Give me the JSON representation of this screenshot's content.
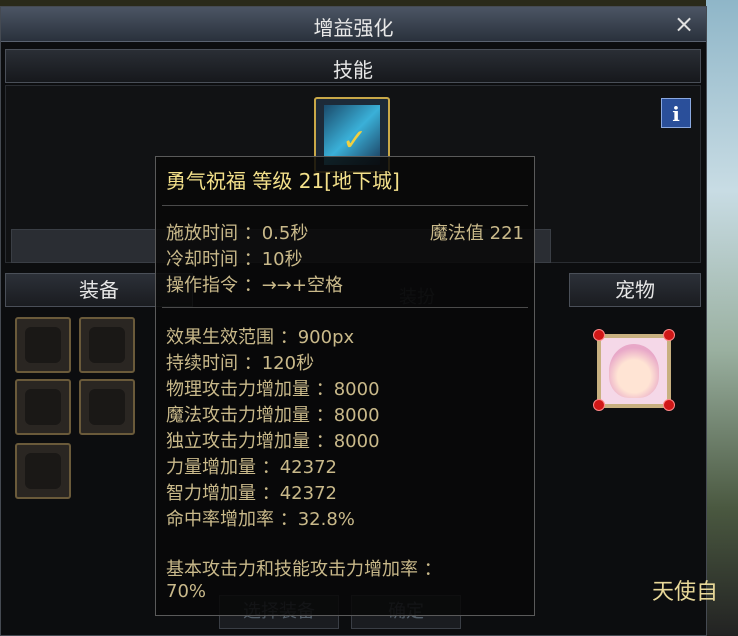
{
  "window": {
    "title": "增益强化",
    "close_symbol": "×",
    "section_title": "技能",
    "info_symbol": "i"
  },
  "panels": {
    "equipment_header": "装备",
    "pet_header": "宠物",
    "ghost_dress": "装扮",
    "ghost_select": "选择装备",
    "ghost_confirm": "确定"
  },
  "tooltip": {
    "title": "勇气祝福 等级 21[地下城]",
    "cast_time": "施放时间 ：0.5秒",
    "mp_label": "魔法值 221",
    "cooldown": "冷却时间 ：10秒",
    "command": "操作指令 ：→→+空格",
    "range": "效果生效范围 ：900px",
    "duration": "持续时间 ：120秒",
    "phys_atk": "物理攻击力增加量 ：8000",
    "mag_atk": "魔法攻击力增加量 ：8000",
    "ind_atk": "独立攻击力增加量 ：8000",
    "str": "力量增加量 ：42372",
    "int": "智力增加量 ：42372",
    "hit": "命中率增加率 ：32.8%",
    "base_rate": "基本攻击力和技能攻击力增加率 ：",
    "base_rate_value": "70%"
  },
  "background": {
    "fragment": "天使自"
  },
  "colors": {
    "tooltip_title": "#f3e08a",
    "tooltip_text": "#c9b98a",
    "slot_border": "#6a5a3a"
  }
}
